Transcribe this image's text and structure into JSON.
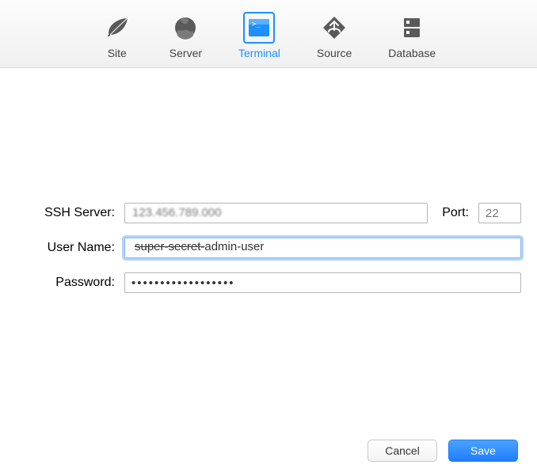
{
  "tabs": [
    {
      "id": "site",
      "label": "Site"
    },
    {
      "id": "server",
      "label": "Server"
    },
    {
      "id": "terminal",
      "label": "Terminal"
    },
    {
      "id": "source",
      "label": "Source"
    },
    {
      "id": "database",
      "label": "Database"
    }
  ],
  "active_tab": "terminal",
  "form": {
    "ssh_label": "SSH Server:",
    "ssh_value_display": "123.456.789.000",
    "port_label": "Port:",
    "port_placeholder": "22",
    "user_label": "User Name:",
    "user_value_struck": "super-secret-",
    "user_value_rest": "admin-user",
    "password_label": "Password:",
    "password_value": "••••••••••••••••••"
  },
  "buttons": {
    "cancel": "Cancel",
    "save": "Save"
  },
  "colors": {
    "accent": "#1e90ff"
  }
}
